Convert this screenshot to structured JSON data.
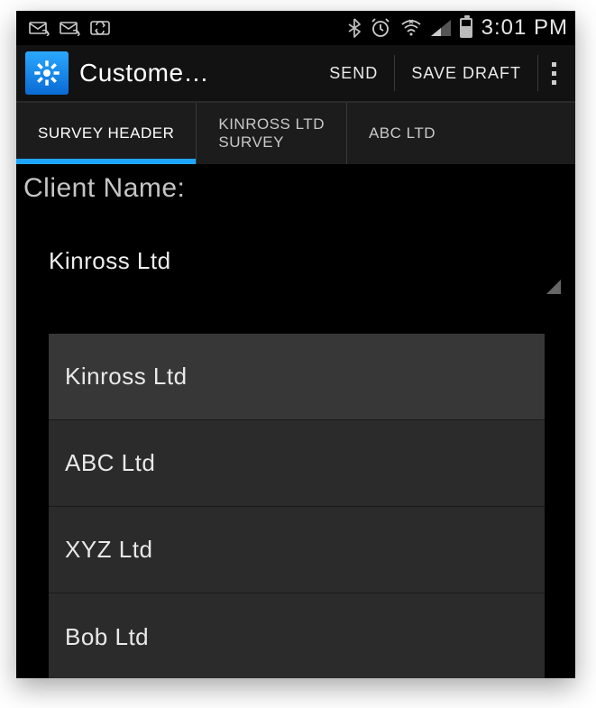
{
  "status": {
    "time": "3:01 PM"
  },
  "appbar": {
    "title": "Custome…",
    "send": "SEND",
    "save_draft": "SAVE DRAFT"
  },
  "tabs": [
    {
      "label": "SURVEY HEADER",
      "active": true
    },
    {
      "label": "KINROSS LTD\nSURVEY",
      "active": false
    },
    {
      "label": "ABC LTD",
      "active": false
    }
  ],
  "form": {
    "client_name_label": "Client Name:",
    "client_name_value": "Kinross Ltd"
  },
  "dropdown": {
    "options": [
      "Kinross Ltd",
      "ABC Ltd",
      "XYZ Ltd",
      "Bob Ltd"
    ],
    "selected_index": 0
  }
}
